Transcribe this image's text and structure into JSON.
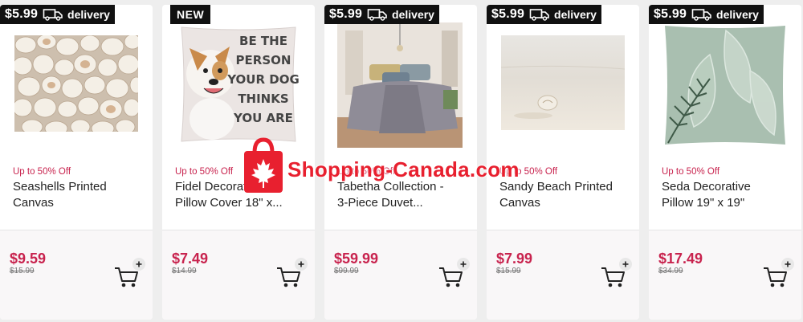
{
  "products": [
    {
      "badge": {
        "type": "delivery",
        "price": "$5.99",
        "word": "delivery"
      },
      "promo": "Up to 50% Off",
      "title_line1": "Seashells Printed",
      "title_line2": "Canvas",
      "sale_price": "$9.59",
      "original_price": "$15.99",
      "image": "seashells-canvas"
    },
    {
      "badge": {
        "type": "new",
        "label": "NEW"
      },
      "promo": "Up to 50% Off",
      "title_line1": "Fidel Decorative",
      "title_line2": "Pillow Cover 18\" x...",
      "sale_price": "$7.49",
      "original_price": "$14.99",
      "image": "dog-pillow",
      "image_text": [
        "BE THE",
        "PERSON",
        "YOUR DOG",
        "THINKS",
        "YOU ARE"
      ]
    },
    {
      "badge": {
        "type": "delivery",
        "price": "$5.99",
        "word": "delivery"
      },
      "promo": "Up to 50% Off",
      "title_line1": "Tabetha Collection -",
      "title_line2": "3-Piece Duvet...",
      "sale_price": "$59.99",
      "original_price": "$99.99",
      "image": "bedroom-duvet"
    },
    {
      "badge": {
        "type": "delivery",
        "price": "$5.99",
        "word": "delivery"
      },
      "promo": "Up to 50% Off",
      "title_line1": "Sandy Beach Printed",
      "title_line2": "Canvas",
      "sale_price": "$7.99",
      "original_price": "$15.99",
      "image": "beach-canvas"
    },
    {
      "badge": {
        "type": "delivery",
        "price": "$5.99",
        "word": "delivery"
      },
      "promo": "Up to 50% Off",
      "title_line1": "Seda Decorative",
      "title_line2": "Pillow 19\" x 19\"",
      "sale_price": "$17.49",
      "original_price": "$34.99",
      "image": "leaf-pillow"
    }
  ],
  "watermark": {
    "text": "Shopping-Canada.com"
  },
  "icons": {
    "cart": "cart-add-icon",
    "truck": "truck-icon",
    "bag": "shopping-bag-maple-icon"
  },
  "colors": {
    "accent": "#c8234e",
    "badge_bg": "#111111",
    "watermark": "#e8202f"
  }
}
